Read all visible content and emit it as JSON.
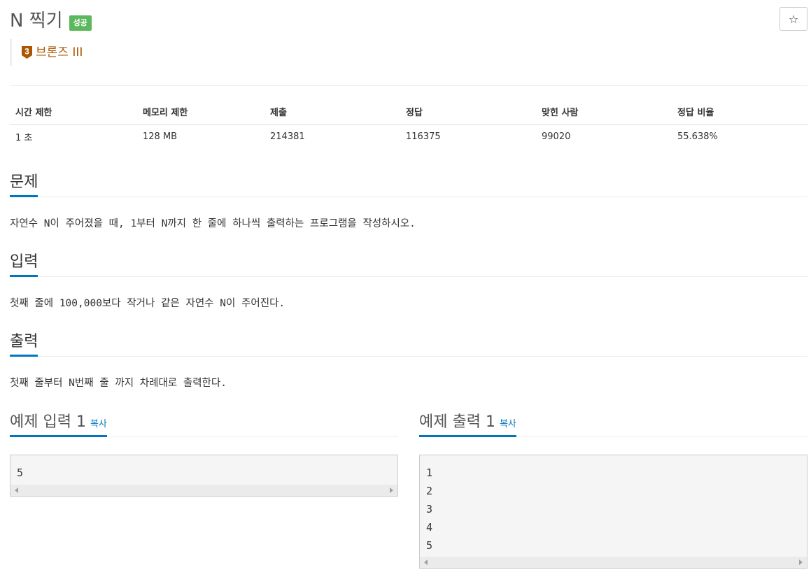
{
  "header": {
    "title": "N 찍기",
    "result_badge": "성공",
    "star_icon": "☆",
    "tier_level": "3",
    "tier_label": "브론즈 III"
  },
  "colors": {
    "badge_green": "#5cb85c",
    "tier_bronze": "#ad5600",
    "accent_blue": "#0076c0"
  },
  "info_table": {
    "headers": [
      "시간 제한",
      "메모리 제한",
      "제출",
      "정답",
      "맞힌 사람",
      "정답 비율"
    ],
    "values": [
      "1 초",
      "128 MB",
      "214381",
      "116375",
      "99020",
      "55.638%"
    ]
  },
  "sections": {
    "problem": {
      "title": "문제",
      "text": "자연수 N이 주어졌을 때, 1부터 N까지 한 줄에 하나씩 출력하는 프로그램을 작성하시오."
    },
    "input": {
      "title": "입력",
      "text": "첫째 줄에 100,000보다 작거나 같은 자연수 N이 주어진다."
    },
    "output": {
      "title": "출력",
      "text": "첫째 줄부터 N번째 줄 까지 차례대로 출력한다."
    }
  },
  "samples": {
    "input": {
      "title": "예제 입력 1",
      "copy_label": "복사",
      "lines": [
        "5"
      ]
    },
    "output": {
      "title": "예제 출력 1",
      "copy_label": "복사",
      "lines": [
        "1",
        "2",
        "3",
        "4",
        "5"
      ]
    }
  }
}
